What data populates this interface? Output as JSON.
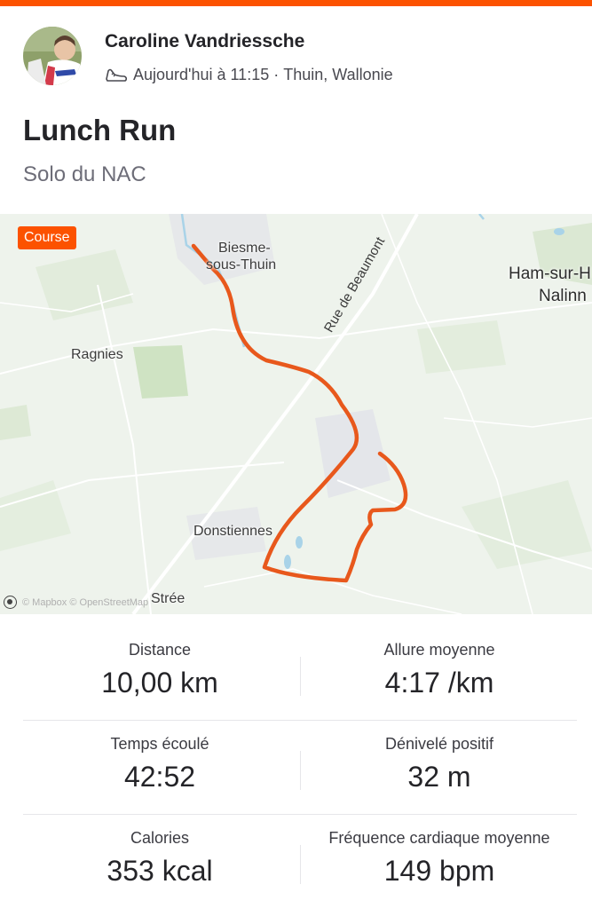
{
  "athlete": {
    "name": "Caroline Vandriessche",
    "timestamp": "Aujourd'hui à 11:15",
    "separator": "·",
    "location": "Thuin, Wallonie"
  },
  "activity": {
    "title": "Lunch Run",
    "description": "Solo du NAC",
    "sport_badge": "Course"
  },
  "map": {
    "labels": {
      "village_top": "Biesme-",
      "village_top_2": "sous-Thuin",
      "ragnies": "Ragnies",
      "ham": "Ham-sur-H",
      "nalinnes": "Nalinn",
      "donstiennes": "Donstiennes",
      "stree": "Strée",
      "road": "Rue de Beaumont"
    },
    "attribution": "© Mapbox © OpenStreetMap",
    "route_color": "#e8581c"
  },
  "stats": {
    "distance": {
      "label": "Distance",
      "value": "10,00 km"
    },
    "pace": {
      "label": "Allure moyenne",
      "value": "4:17 /km"
    },
    "elapsed": {
      "label": "Temps écoulé",
      "value": "42:52"
    },
    "elevation": {
      "label": "Dénivelé positif",
      "value": "32 m"
    },
    "calories": {
      "label": "Calories",
      "value": "353 kcal"
    },
    "heart_rate": {
      "label": "Fréquence cardiaque moyenne",
      "value": "149 bpm"
    }
  },
  "colors": {
    "brand": "#fc5200",
    "text": "#242428",
    "muted": "#6d6d78"
  }
}
